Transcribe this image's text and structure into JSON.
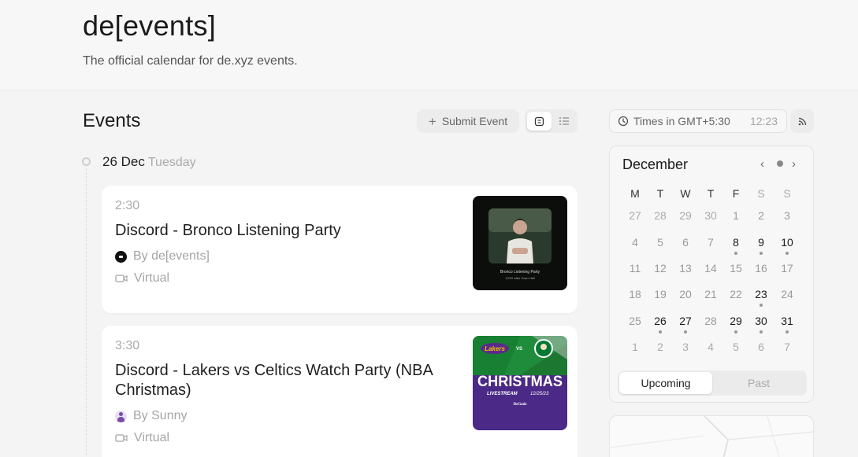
{
  "header": {
    "title": "de[events]",
    "subtitle": "The official calendar for de.xyz events."
  },
  "events_section": {
    "title": "Events",
    "submit_label": "Submit Event",
    "view_options": [
      "calendar-view-icon",
      "list-view-icon"
    ]
  },
  "day": {
    "date": "26 Dec",
    "weekday": "Tuesday"
  },
  "events": [
    {
      "time": "2:30",
      "title": "Discord - Bronco Listening Party",
      "host": "By de[events]",
      "location": "Virtual",
      "thumb": {
        "caption": "Bronco Listening Party",
        "subcaption": "12/22 after Town Hall"
      }
    },
    {
      "time": "3:30",
      "title": "Discord - Lakers vs Celtics Watch Party (NBA Christmas)",
      "host": "By Sunny",
      "location": "Virtual",
      "thumb": {
        "team1": "Lakers",
        "vs": "VS",
        "headline": "CHRISTMAS",
        "tag": "LIVESTREAM",
        "date": "12/25/23",
        "brand": "DeGods"
      }
    }
  ],
  "timezone": {
    "label": "Times in GMT+5:30",
    "time": "12:23"
  },
  "calendar": {
    "month": "December",
    "weekdays": [
      "M",
      "T",
      "W",
      "T",
      "F",
      "S",
      "S"
    ],
    "weeks": [
      [
        {
          "d": "27",
          "t": "other"
        },
        {
          "d": "28",
          "t": "other"
        },
        {
          "d": "29",
          "t": "other"
        },
        {
          "d": "30",
          "t": "other"
        },
        {
          "d": "1",
          "t": "cur"
        },
        {
          "d": "2",
          "t": "cur"
        },
        {
          "d": "3",
          "t": "cur"
        }
      ],
      [
        {
          "d": "4",
          "t": "cur"
        },
        {
          "d": "5",
          "t": "cur"
        },
        {
          "d": "6",
          "t": "cur"
        },
        {
          "d": "7",
          "t": "cur"
        },
        {
          "d": "8",
          "t": "event"
        },
        {
          "d": "9",
          "t": "event"
        },
        {
          "d": "10",
          "t": "event"
        }
      ],
      [
        {
          "d": "11",
          "t": "cur"
        },
        {
          "d": "12",
          "t": "cur"
        },
        {
          "d": "13",
          "t": "cur"
        },
        {
          "d": "14",
          "t": "cur"
        },
        {
          "d": "15",
          "t": "cur"
        },
        {
          "d": "16",
          "t": "cur"
        },
        {
          "d": "17",
          "t": "cur"
        }
      ],
      [
        {
          "d": "18",
          "t": "cur"
        },
        {
          "d": "19",
          "t": "cur"
        },
        {
          "d": "20",
          "t": "cur"
        },
        {
          "d": "21",
          "t": "cur"
        },
        {
          "d": "22",
          "t": "cur"
        },
        {
          "d": "23",
          "t": "event"
        },
        {
          "d": "24",
          "t": "cur"
        }
      ],
      [
        {
          "d": "25",
          "t": "cur"
        },
        {
          "d": "26",
          "t": "event"
        },
        {
          "d": "27",
          "t": "event"
        },
        {
          "d": "28",
          "t": "cur"
        },
        {
          "d": "29",
          "t": "event"
        },
        {
          "d": "30",
          "t": "event"
        },
        {
          "d": "31",
          "t": "event"
        }
      ],
      [
        {
          "d": "1",
          "t": "other"
        },
        {
          "d": "2",
          "t": "other"
        },
        {
          "d": "3",
          "t": "other"
        },
        {
          "d": "4",
          "t": "other"
        },
        {
          "d": "5",
          "t": "other"
        },
        {
          "d": "6",
          "t": "other"
        },
        {
          "d": "7",
          "t": "other"
        }
      ]
    ],
    "tabs": {
      "upcoming": "Upcoming",
      "past": "Past"
    }
  }
}
